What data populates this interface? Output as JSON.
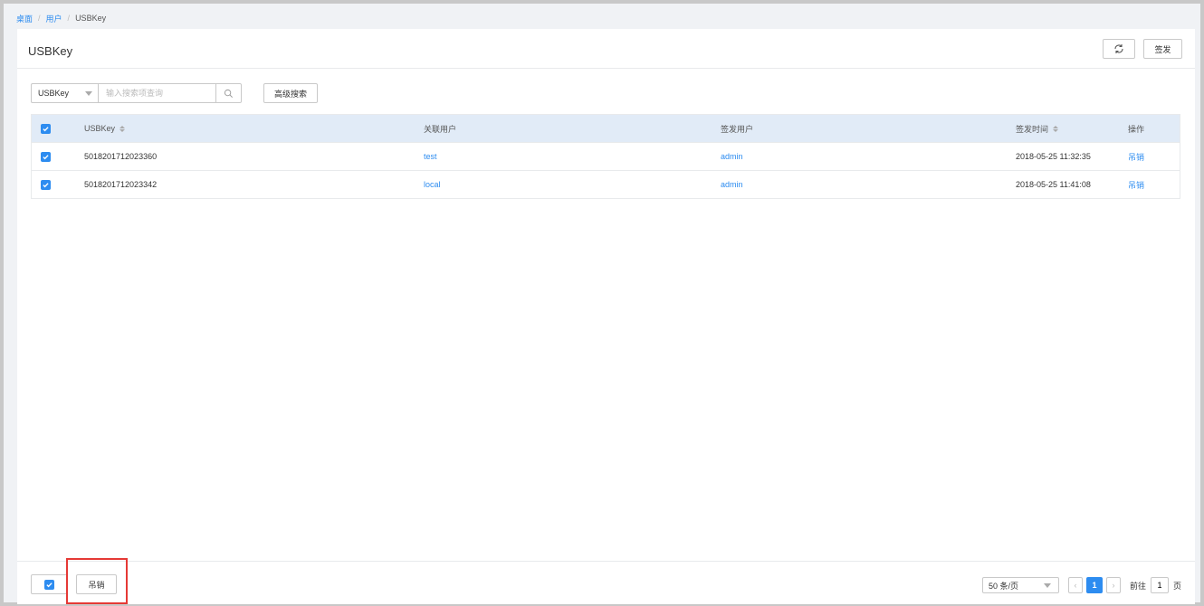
{
  "breadcrumb": {
    "items": [
      "桌面",
      "用户"
    ],
    "current": "USBKey"
  },
  "header": {
    "title": "USBKey",
    "issue_label": "签发",
    "refresh_icon": "refresh-icon"
  },
  "search": {
    "field_selected": "USBKey",
    "placeholder": "输入搜索项查询",
    "advanced_label": "高级搜索",
    "search_icon": "search-icon"
  },
  "table": {
    "columns": [
      "USBKey",
      "关联用户",
      "签发用户",
      "签发时间",
      "操作"
    ],
    "rows": [
      {
        "key": "5018201712023360",
        "user": "test",
        "issuer": "admin",
        "time": "2018-05-25 11:32:35",
        "action": "吊销",
        "checked": true
      },
      {
        "key": "5018201712023342",
        "user": "local",
        "issuer": "admin",
        "time": "2018-05-25 11:41:08",
        "action": "吊销",
        "checked": true
      }
    ]
  },
  "footer": {
    "revoke_label": "吊销",
    "page_size": "50 条/页",
    "current_page": "1",
    "goto_prefix": "前往",
    "goto_value": "1",
    "goto_suffix": "页"
  },
  "colors": {
    "accent": "#2d8cf0",
    "header_bg": "#e1ebf7",
    "highlight": "#e53935"
  }
}
